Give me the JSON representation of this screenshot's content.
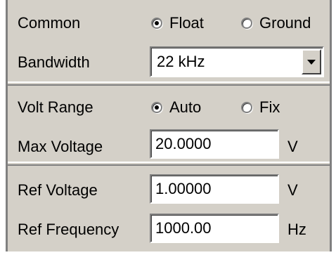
{
  "common": {
    "label": "Common",
    "options": [
      {
        "label": "Float",
        "selected": true
      },
      {
        "label": "Ground",
        "selected": false
      }
    ]
  },
  "bandwidth": {
    "label": "Bandwidth",
    "value": "22 kHz"
  },
  "volt_range": {
    "label": "Volt Range",
    "options": [
      {
        "label": "Auto",
        "selected": true
      },
      {
        "label": "Fix",
        "selected": false
      }
    ]
  },
  "max_voltage": {
    "label": "Max Voltage",
    "value": "20.0000",
    "unit": "V"
  },
  "ref_voltage": {
    "label": "Ref Voltage",
    "value": "1.00000",
    "unit": "V"
  },
  "ref_frequency": {
    "label": "Ref Frequency",
    "value": "1000.00",
    "unit": "Hz"
  }
}
